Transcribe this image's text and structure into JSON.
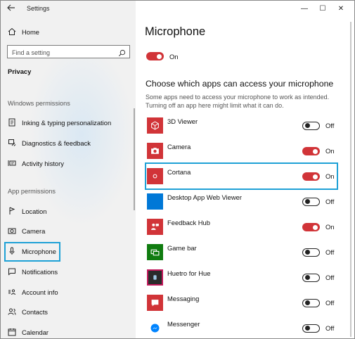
{
  "window": {
    "app_title": "Settings",
    "minimize": "—",
    "maximize": "☐",
    "close": "✕"
  },
  "sidebar": {
    "home_label": "Home",
    "search_placeholder": "Find a setting",
    "section": "Privacy",
    "group_windows": "Windows permissions",
    "windows_items": [
      {
        "label": "Inking & typing personalization",
        "icon": "inking-icon"
      },
      {
        "label": "Diagnostics & feedback",
        "icon": "diagnostics-icon"
      },
      {
        "label": "Activity history",
        "icon": "activity-history-icon"
      }
    ],
    "group_apps": "App permissions",
    "app_items": [
      {
        "label": "Location",
        "icon": "location-icon"
      },
      {
        "label": "Camera",
        "icon": "camera-icon"
      },
      {
        "label": "Microphone",
        "icon": "microphone-icon",
        "selected": true
      },
      {
        "label": "Notifications",
        "icon": "notifications-icon"
      },
      {
        "label": "Account info",
        "icon": "account-info-icon"
      },
      {
        "label": "Contacts",
        "icon": "contacts-icon"
      },
      {
        "label": "Calendar",
        "icon": "calendar-icon"
      }
    ]
  },
  "main": {
    "title": "Microphone",
    "master_state": "On",
    "heading": "Choose which apps can access your microphone",
    "description": "Some apps need to access your microphone to work as intended. Turning off an app here might limit what it can do.",
    "apps": [
      {
        "name": "3D Viewer",
        "state": "Off",
        "on": false,
        "tile_color": "#d13438"
      },
      {
        "name": "Camera",
        "state": "On",
        "on": true,
        "tile_color": "#d13438"
      },
      {
        "name": "Cortana",
        "state": "On",
        "on": true,
        "tile_color": "#d13438",
        "highlighted": true
      },
      {
        "name": "Desktop App Web Viewer",
        "state": "Off",
        "on": false,
        "tile_color": "#0078d7"
      },
      {
        "name": "Feedback Hub",
        "state": "On",
        "on": true,
        "tile_color": "#d13438"
      },
      {
        "name": "Game bar",
        "state": "Off",
        "on": false,
        "tile_color": "#107c10"
      },
      {
        "name": "Huetro for Hue",
        "state": "Off",
        "on": false,
        "tile_color": "#2b2b2b"
      },
      {
        "name": "Messaging",
        "state": "Off",
        "on": false,
        "tile_color": "#d13438"
      },
      {
        "name": "Messenger",
        "state": "Off",
        "on": false,
        "tile_color": "#0084ff"
      }
    ]
  },
  "colors": {
    "accent": "#d13438",
    "highlight": "#1ea1d6",
    "sidebar_bg": "#f1f1f1"
  }
}
